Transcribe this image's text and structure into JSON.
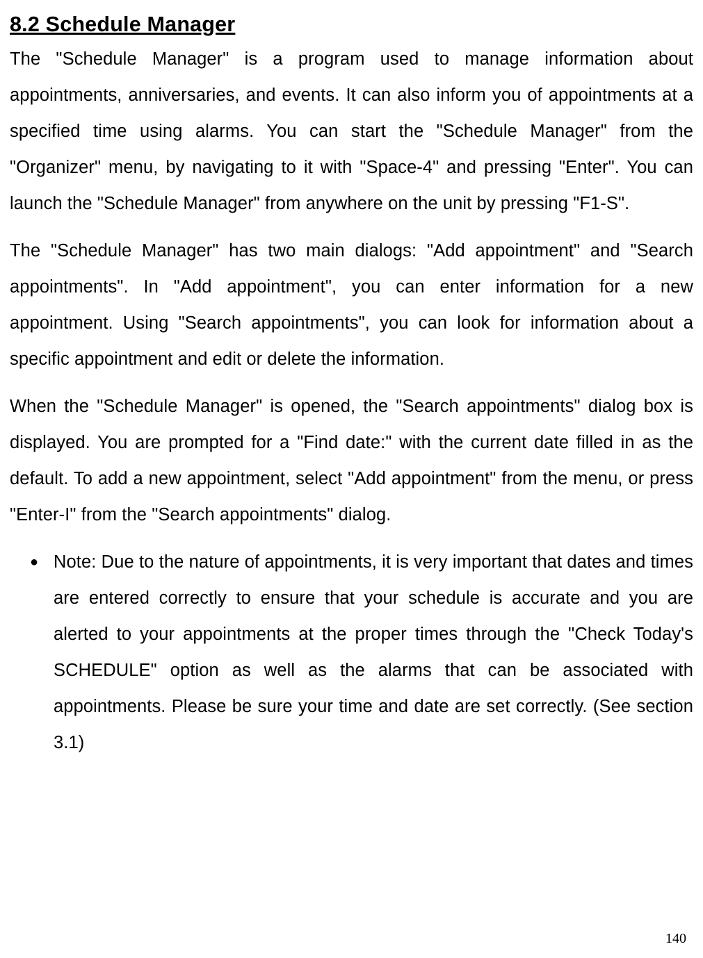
{
  "heading": "8.2 Schedule Manager",
  "paragraphs": {
    "p1": "The \"Schedule Manager\" is a program used to manage information about appointments, anniversaries, and events. It can also inform you of appointments at a specified time using alarms. You can start the \"Schedule Manager\" from the \"Organizer\" menu, by navigating to it with \"Space-4\" and pressing \"Enter\". You can launch the \"Schedule Manager\" from anywhere on the unit by pressing \"F1-S\".",
    "p2": "The \"Schedule Manager\" has two main dialogs: \"Add appointment\" and \"Search appointments\". In \"Add appointment\", you can enter information for a new appointment. Using \"Search appointments\", you can look for information about a specific appointment and edit or delete the information.",
    "p3": "When the \"Schedule Manager\" is opened, the \"Search appointments\" dialog box is displayed. You are prompted for a \"Find date:\" with the current date filled in as the default. To add a new appointment, select \"Add appointment\" from the menu, or press \"Enter-I\" from the \"Search appointments\" dialog."
  },
  "note": "Note: Due to the nature of appointments, it is very important that dates and times are entered correctly to ensure that your schedule is accurate and you are alerted to your appointments at the proper times through the \"Check Today's SCHEDULE\" option as well as the alarms that can be associated with appointments. Please be sure your time and date are set correctly. (See section 3.1)",
  "page_number": "140"
}
